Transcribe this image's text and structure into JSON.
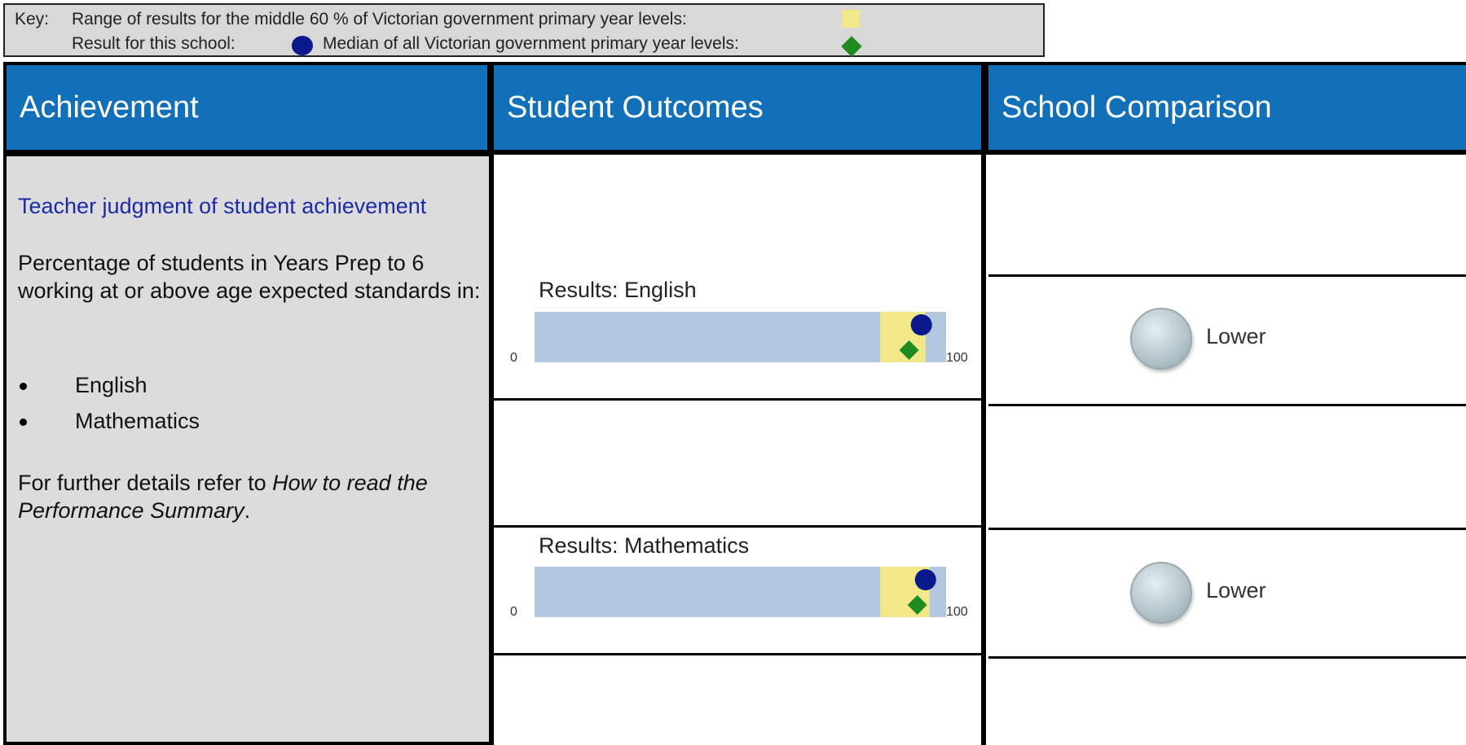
{
  "key": {
    "prefix": "Key:",
    "range_label": "Range of results for the middle 60 % of Victorian government primary year levels:",
    "school_label": "Result for this school:",
    "median_label": "Median of all Victorian government primary year levels:"
  },
  "headers": {
    "achievement": "Achievement",
    "student_outcomes": "Student Outcomes",
    "school_comparison": "School Comparison"
  },
  "achievement": {
    "link_title": "Teacher judgment of student achievement",
    "description": "Percentage of students in Years Prep to 6 working at or above age expected standards in:",
    "bullets": [
      "English",
      "Mathematics"
    ],
    "further_prefix": "For further details refer to ",
    "further_italic": "How to read the Performance Summary",
    "further_suffix": "."
  },
  "colors": {
    "header_blue": "#1170b8",
    "bar_blue": "#b3c7e0",
    "range_yellow": "#f2e88a",
    "school_marker": "#0a1a8c",
    "median_marker": "#1f8a1f"
  },
  "chart_data": [
    {
      "type": "bar",
      "title": "Results: English",
      "xlim": [
        0,
        100
      ],
      "tick_labels": [
        "0",
        "100"
      ],
      "range_middle_60": [
        84,
        95
      ],
      "school_result": 94,
      "median": 91
    },
    {
      "type": "bar",
      "title": "Results: Mathematics",
      "xlim": [
        0,
        100
      ],
      "tick_labels": [
        "0",
        "100"
      ],
      "range_middle_60": [
        84,
        96
      ],
      "school_result": 95,
      "median": 93
    }
  ],
  "comparison": [
    {
      "label": "Lower"
    },
    {
      "label": "Lower"
    }
  ]
}
